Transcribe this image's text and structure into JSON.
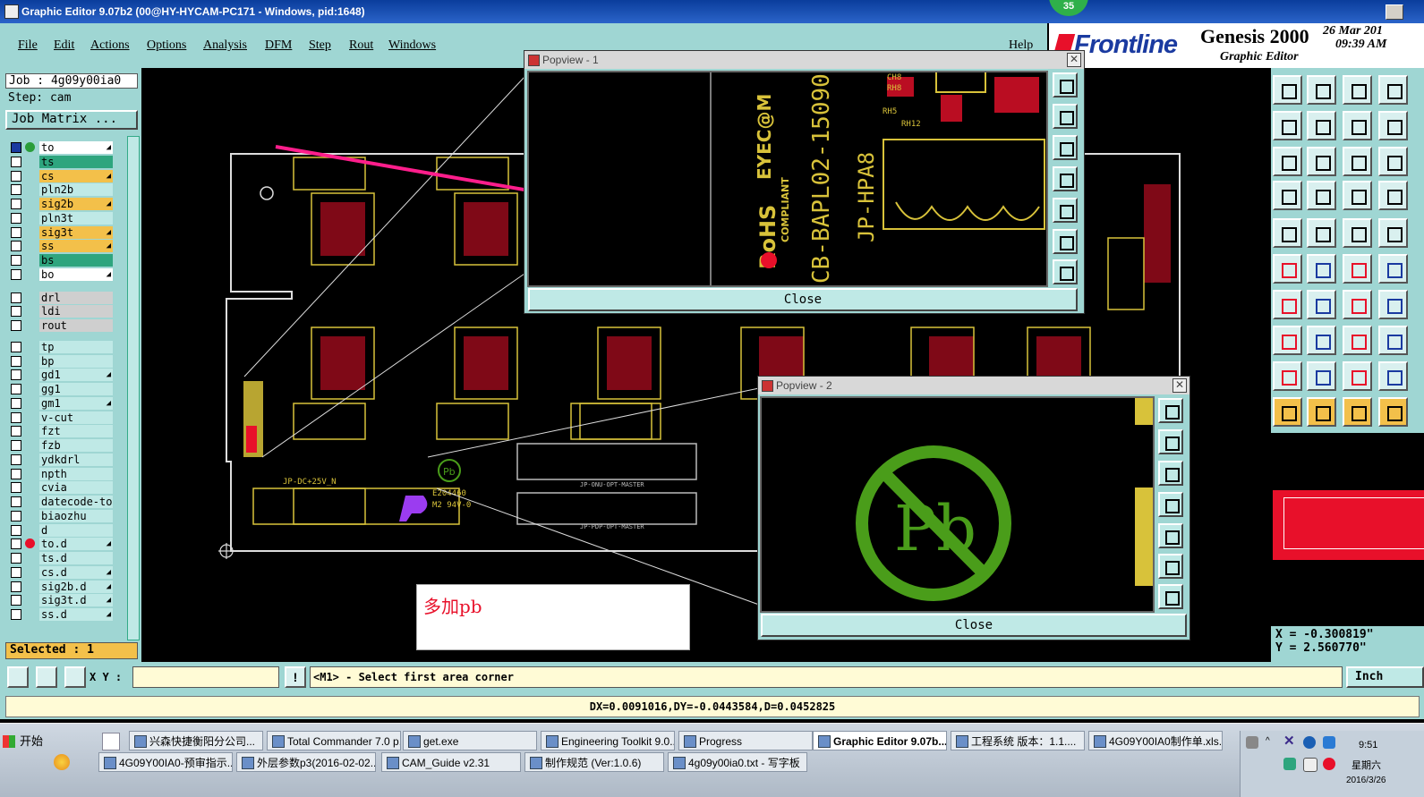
{
  "window": {
    "title": "Graphic Editor 9.07b2 (00@HY-HYCAM-PC171 - Windows, pid:1648)",
    "badge": "35"
  },
  "menu": {
    "items": [
      "File",
      "Edit",
      "Actions",
      "Options",
      "Analysis",
      "DFM",
      "Step",
      "Rout",
      "Windows"
    ],
    "help": "Help"
  },
  "brand": {
    "logo": "Frontline",
    "product": "Genesis 2000",
    "subtitle": "Graphic Editor",
    "date": "26 Mar 201",
    "time": "09:39 AM"
  },
  "job": {
    "job": "Job : 4g09y00ia0",
    "step": "Step: cam",
    "matrix_button": "Job Matrix ..."
  },
  "layers": [
    {
      "name": "to",
      "color": "#ffffff",
      "dot": "#2a9d3a",
      "arrow": true
    },
    {
      "name": "ts",
      "color": "#2ea57e",
      "dot": "",
      "arrow": false
    },
    {
      "name": "cs",
      "color": "#f3c04a",
      "dot": "",
      "arrow": true
    },
    {
      "name": "pln2b",
      "color": "#bfe9e6",
      "dot": "",
      "arrow": false
    },
    {
      "name": "sig2b",
      "color": "#f3c04a",
      "dot": "",
      "arrow": true
    },
    {
      "name": "pln3t",
      "color": "#bfe9e6",
      "dot": "",
      "arrow": false
    },
    {
      "name": "sig3t",
      "color": "#f3c04a",
      "dot": "",
      "arrow": true
    },
    {
      "name": "ss",
      "color": "#f3c04a",
      "dot": "",
      "arrow": true
    },
    {
      "name": "bs",
      "color": "#2ea57e",
      "dot": "",
      "arrow": false
    },
    {
      "name": "bo",
      "color": "#ffffff",
      "dot": "",
      "arrow": true
    },
    {
      "name": "drl",
      "color": "#cfcfcf",
      "dot": "",
      "arrow": false
    },
    {
      "name": "ldi",
      "color": "#cfcfcf",
      "dot": "",
      "arrow": false
    },
    {
      "name": "rout",
      "color": "#cfcfcf",
      "dot": "",
      "arrow": false
    },
    {
      "name": "tp",
      "color": "#bfe9e6",
      "dot": "",
      "arrow": false
    },
    {
      "name": "bp",
      "color": "#bfe9e6",
      "dot": "",
      "arrow": false
    },
    {
      "name": "gd1",
      "color": "#bfe9e6",
      "dot": "",
      "arrow": true
    },
    {
      "name": "gg1",
      "color": "#bfe9e6",
      "dot": "",
      "arrow": false
    },
    {
      "name": "gm1",
      "color": "#bfe9e6",
      "dot": "",
      "arrow": true
    },
    {
      "name": "v-cut",
      "color": "#bfe9e6",
      "dot": "",
      "arrow": false
    },
    {
      "name": "fzt",
      "color": "#bfe9e6",
      "dot": "",
      "arrow": false
    },
    {
      "name": "fzb",
      "color": "#bfe9e6",
      "dot": "",
      "arrow": false
    },
    {
      "name": "ydkdrl",
      "color": "#bfe9e6",
      "dot": "",
      "arrow": false
    },
    {
      "name": "npth",
      "color": "#bfe9e6",
      "dot": "",
      "arrow": false
    },
    {
      "name": "cvia",
      "color": "#bfe9e6",
      "dot": "",
      "arrow": false
    },
    {
      "name": "datecode-to",
      "color": "#bfe9e6",
      "dot": "",
      "arrow": false
    },
    {
      "name": "biaozhu",
      "color": "#bfe9e6",
      "dot": "",
      "arrow": false
    },
    {
      "name": "d",
      "color": "#bfe9e6",
      "dot": "",
      "arrow": false
    },
    {
      "name": "to.d",
      "color": "#bfe9e6",
      "dot": "#e8102a",
      "arrow": true
    },
    {
      "name": "ts.d",
      "color": "#bfe9e6",
      "dot": "",
      "arrow": false
    },
    {
      "name": "cs.d",
      "color": "#bfe9e6",
      "dot": "",
      "arrow": true
    },
    {
      "name": "sig2b.d",
      "color": "#bfe9e6",
      "dot": "",
      "arrow": true
    },
    {
      "name": "sig3t.d",
      "color": "#bfe9e6",
      "dot": "",
      "arrow": true
    },
    {
      "name": "ss.d",
      "color": "#bfe9e6",
      "dot": "",
      "arrow": true
    }
  ],
  "selected": "Selected : 1",
  "popview1": {
    "title": "Popview - 1",
    "close": "Close",
    "labels": {
      "eyecom": "EYEC@M",
      "rohs": "RoHS",
      "compliant": "COMPLIANT",
      "part": "CB-BAPL02-15090",
      "jphpa8": "JP-HPA8",
      "rh5": "RH5",
      "rh8": "RH8",
      "rh12": "RH12",
      "ch8": "CH8",
      "ch": "RH8"
    }
  },
  "popview2": {
    "title": "Popview - 2",
    "close": "Close",
    "symbol": "Pb"
  },
  "note": "多加pb",
  "pcb": {
    "dc": "JP-DC+25V_N",
    "e20": "E204460",
    "m2": "M2 94V-0",
    "master": "JP-ONU-OPT-MASTER",
    "master2": "JP-PDP-OPT-MASTER"
  },
  "coords": {
    "x": "X = -0.300819\"",
    "y": "Y = 2.560770\""
  },
  "command": {
    "xy_label": "X Y :",
    "xy_value": "",
    "prompt": "<M1> - Select first area corner",
    "units": "Inch"
  },
  "status": "DX=0.0091016,DY=-0.0443584,D=0.0452825",
  "taskbar": {
    "start": "开始",
    "row1": [
      "兴森快捷衡阳分公司...",
      "Total Commander 7.0 p...",
      "get.exe",
      "Engineering Toolkit 9.0...",
      "Progress",
      "Graphic Editor 9.07b...",
      "工程系统  版本：1.1....",
      "4G09Y00IA0制作单.xls..."
    ],
    "row2": [
      "4G09Y00IA0-预审指示....",
      "外层参数p3(2016-02-02...",
      "CAM_Guide v2.31",
      "制作规范 (Ver:1.0.6)",
      "4g09y00ia0.txt - 写字板"
    ],
    "clock_time": "9:51",
    "clock_day": "星期六",
    "clock_date": "2016/3/26"
  },
  "colors": {
    "teal": "#9fd6d3",
    "gold": "#f3c04a",
    "pcb_yellow": "#d8c23a",
    "pcb_red": "#e8102a",
    "pb_green": "#4a9d1a",
    "arrow_magenta": "#ff1e8c"
  }
}
